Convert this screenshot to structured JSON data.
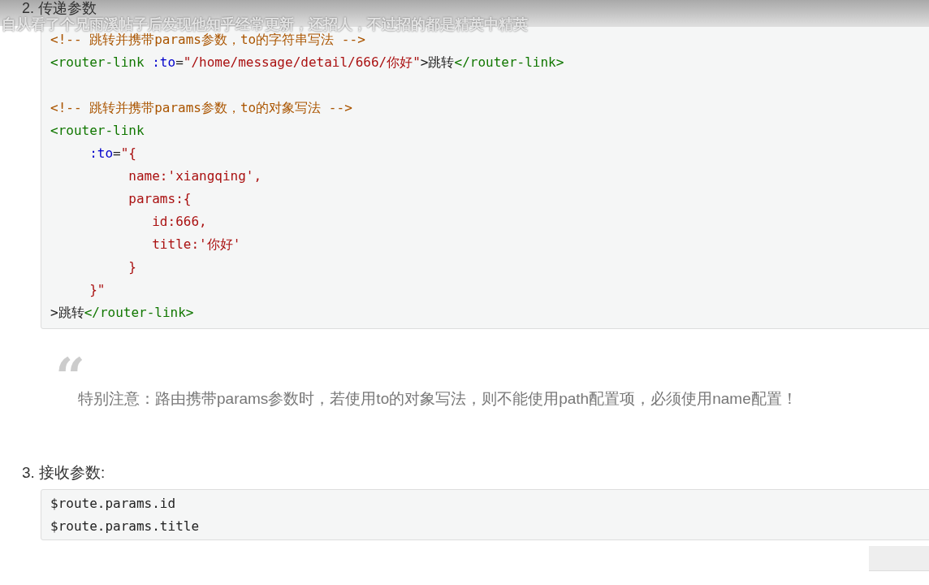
{
  "overlay_comment": "自从看了个兄雨溪帖子后发现他知乎经常更新，还招人，不过招的都是精英中精英",
  "section_2": {
    "heading": "2. 传递参数",
    "code": [
      [
        {
          "kind": "comment",
          "text": "<!-- 跳转并携带params参数，to的字符串写法 -->"
        }
      ],
      [
        {
          "kind": "tag",
          "text": "<router-link"
        },
        {
          "kind": "attr",
          "text": " :to"
        },
        {
          "kind": "plain",
          "text": "="
        },
        {
          "kind": "string",
          "text": "\"/home/message/detail/666/你好\""
        },
        {
          "kind": "plain",
          "text": ">跳转"
        },
        {
          "kind": "tag",
          "text": "</router-link>"
        }
      ],
      [
        {
          "kind": "comment",
          "text": "<!-- 跳转并携带params参数，to的对象写法 -->"
        }
      ],
      [
        {
          "kind": "tag",
          "text": "<router-link"
        }
      ],
      [
        {
          "kind": "attr",
          "text": "     :to"
        },
        {
          "kind": "plain",
          "text": "="
        },
        {
          "kind": "string",
          "text": "\"{"
        }
      ],
      [
        {
          "kind": "string",
          "text": "          name:'xiangqing',"
        }
      ],
      [
        {
          "kind": "string",
          "text": "          params:{"
        }
      ],
      [
        {
          "kind": "string",
          "text": "             id:666,"
        }
      ],
      [
        {
          "kind": "string",
          "text": "             title:'你好'"
        }
      ],
      [
        {
          "kind": "string",
          "text": "          }"
        }
      ],
      [
        {
          "kind": "string",
          "text": "     }\""
        }
      ],
      [
        {
          "kind": "plain",
          "text": ">跳转"
        },
        {
          "kind": "tag",
          "text": "</router-link>"
        }
      ]
    ]
  },
  "note": {
    "quote_mark": "“",
    "text": "特别注意：路由携带params参数时，若使用to的对象写法，则不能使用path配置项，必须使用name配置！"
  },
  "section_3": {
    "heading": "3. 接收参数:",
    "code": [
      [
        {
          "kind": "plain",
          "text": "$route.params.id"
        }
      ],
      [
        {
          "kind": "plain",
          "text": "$route.params.title"
        }
      ]
    ]
  }
}
